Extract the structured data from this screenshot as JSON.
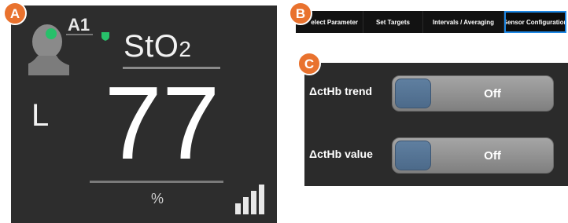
{
  "callouts": {
    "a": "A",
    "b": "B",
    "c": "C"
  },
  "monitor": {
    "channel": "A1",
    "parameter": "StO",
    "parameter_subscript": "2",
    "side": "L",
    "value": "77",
    "unit": "%",
    "avatar_icon": "patient-head-icon",
    "sensor_site_color": "#27c06a",
    "status_icon": "green-shield-icon",
    "signal_icon": "signal-strength-bars-icon"
  },
  "tabs": [
    {
      "label": "elect Parameter"
    },
    {
      "label": "Set Targets"
    },
    {
      "label": "Intervals / Averaging"
    },
    {
      "label": "Sensor Configuration",
      "selected": true
    }
  ],
  "settings": {
    "rows": [
      {
        "label": "ΔctHb trend",
        "state": "Off"
      },
      {
        "label": "ΔctHb value",
        "state": "Off"
      }
    ]
  },
  "colors": {
    "callout_badge": "#e9722e",
    "panel_bg": "#2d2d2d",
    "tab_selected_border": "#1e88e5",
    "toggle_knob": "#56769a"
  }
}
